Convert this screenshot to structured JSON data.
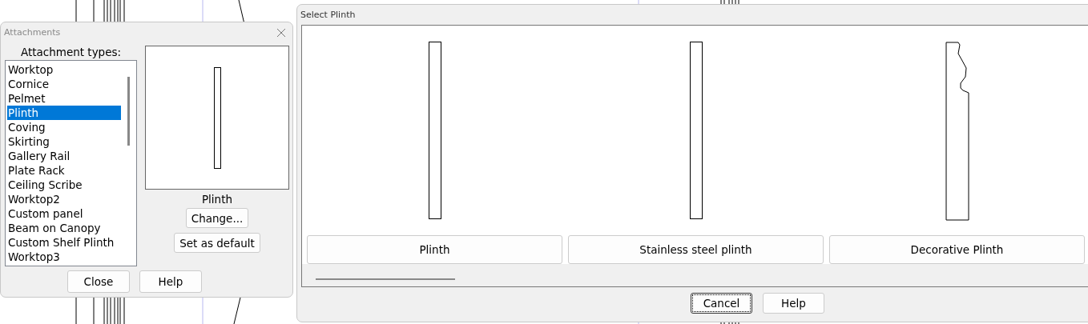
{
  "attachments_dialog": {
    "title": "Attachments",
    "list_label": "Attachment types:",
    "items": [
      {
        "label": "Worktop",
        "selected": false
      },
      {
        "label": "Cornice",
        "selected": false
      },
      {
        "label": "Pelmet",
        "selected": false
      },
      {
        "label": "Plinth",
        "selected": true
      },
      {
        "label": "Coving",
        "selected": false
      },
      {
        "label": "Skirting",
        "selected": false
      },
      {
        "label": "Gallery Rail",
        "selected": false
      },
      {
        "label": "Plate Rack",
        "selected": false
      },
      {
        "label": "Ceiling Scribe",
        "selected": false
      },
      {
        "label": "Worktop2",
        "selected": false
      },
      {
        "label": "Custom panel",
        "selected": false
      },
      {
        "label": "Beam on Canopy",
        "selected": false
      },
      {
        "label": "Custom Shelf Plinth",
        "selected": false
      },
      {
        "label": "Worktop3",
        "selected": false
      }
    ],
    "preview_label": "Plinth",
    "change_button": "Change...",
    "default_button": "Set as default",
    "buttons": [
      {
        "label": "Close",
        "focused": false
      },
      {
        "label": "Help",
        "focused": false
      }
    ]
  },
  "select_dialog": {
    "title": "Select Plinth",
    "options": [
      {
        "label": "Plinth",
        "kind": "plain"
      },
      {
        "label": "Stainless steel plinth",
        "kind": "plain"
      },
      {
        "label": "Decorative Plinth",
        "kind": "profile"
      }
    ],
    "buttons": [
      {
        "label": "Cancel",
        "focused": true
      },
      {
        "label": "Help",
        "focused": false
      }
    ]
  }
}
